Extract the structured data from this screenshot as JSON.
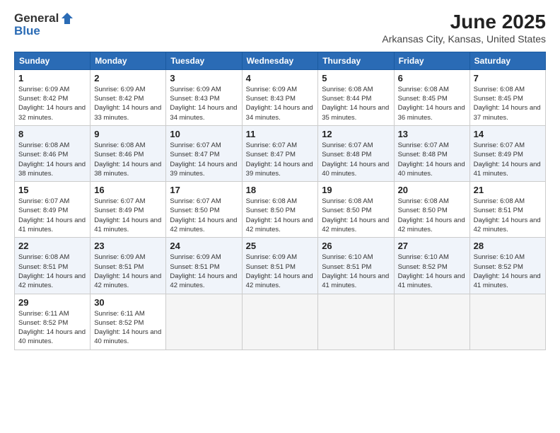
{
  "logo": {
    "general": "General",
    "blue": "Blue"
  },
  "title": "June 2025",
  "subtitle": "Arkansas City, Kansas, United States",
  "headers": [
    "Sunday",
    "Monday",
    "Tuesday",
    "Wednesday",
    "Thursday",
    "Friday",
    "Saturday"
  ],
  "weeks": [
    [
      {
        "day": "1",
        "sunrise": "6:09 AM",
        "sunset": "8:42 PM",
        "daylight": "14 hours and 32 minutes."
      },
      {
        "day": "2",
        "sunrise": "6:09 AM",
        "sunset": "8:42 PM",
        "daylight": "14 hours and 33 minutes."
      },
      {
        "day": "3",
        "sunrise": "6:09 AM",
        "sunset": "8:43 PM",
        "daylight": "14 hours and 34 minutes."
      },
      {
        "day": "4",
        "sunrise": "6:09 AM",
        "sunset": "8:43 PM",
        "daylight": "14 hours and 34 minutes."
      },
      {
        "day": "5",
        "sunrise": "6:08 AM",
        "sunset": "8:44 PM",
        "daylight": "14 hours and 35 minutes."
      },
      {
        "day": "6",
        "sunrise": "6:08 AM",
        "sunset": "8:45 PM",
        "daylight": "14 hours and 36 minutes."
      },
      {
        "day": "7",
        "sunrise": "6:08 AM",
        "sunset": "8:45 PM",
        "daylight": "14 hours and 37 minutes."
      }
    ],
    [
      {
        "day": "8",
        "sunrise": "6:08 AM",
        "sunset": "8:46 PM",
        "daylight": "14 hours and 38 minutes."
      },
      {
        "day": "9",
        "sunrise": "6:08 AM",
        "sunset": "8:46 PM",
        "daylight": "14 hours and 38 minutes."
      },
      {
        "day": "10",
        "sunrise": "6:07 AM",
        "sunset": "8:47 PM",
        "daylight": "14 hours and 39 minutes."
      },
      {
        "day": "11",
        "sunrise": "6:07 AM",
        "sunset": "8:47 PM",
        "daylight": "14 hours and 39 minutes."
      },
      {
        "day": "12",
        "sunrise": "6:07 AM",
        "sunset": "8:48 PM",
        "daylight": "14 hours and 40 minutes."
      },
      {
        "day": "13",
        "sunrise": "6:07 AM",
        "sunset": "8:48 PM",
        "daylight": "14 hours and 40 minutes."
      },
      {
        "day": "14",
        "sunrise": "6:07 AM",
        "sunset": "8:49 PM",
        "daylight": "14 hours and 41 minutes."
      }
    ],
    [
      {
        "day": "15",
        "sunrise": "6:07 AM",
        "sunset": "8:49 PM",
        "daylight": "14 hours and 41 minutes."
      },
      {
        "day": "16",
        "sunrise": "6:07 AM",
        "sunset": "8:49 PM",
        "daylight": "14 hours and 41 minutes."
      },
      {
        "day": "17",
        "sunrise": "6:07 AM",
        "sunset": "8:50 PM",
        "daylight": "14 hours and 42 minutes."
      },
      {
        "day": "18",
        "sunrise": "6:08 AM",
        "sunset": "8:50 PM",
        "daylight": "14 hours and 42 minutes."
      },
      {
        "day": "19",
        "sunrise": "6:08 AM",
        "sunset": "8:50 PM",
        "daylight": "14 hours and 42 minutes."
      },
      {
        "day": "20",
        "sunrise": "6:08 AM",
        "sunset": "8:50 PM",
        "daylight": "14 hours and 42 minutes."
      },
      {
        "day": "21",
        "sunrise": "6:08 AM",
        "sunset": "8:51 PM",
        "daylight": "14 hours and 42 minutes."
      }
    ],
    [
      {
        "day": "22",
        "sunrise": "6:08 AM",
        "sunset": "8:51 PM",
        "daylight": "14 hours and 42 minutes."
      },
      {
        "day": "23",
        "sunrise": "6:09 AM",
        "sunset": "8:51 PM",
        "daylight": "14 hours and 42 minutes."
      },
      {
        "day": "24",
        "sunrise": "6:09 AM",
        "sunset": "8:51 PM",
        "daylight": "14 hours and 42 minutes."
      },
      {
        "day": "25",
        "sunrise": "6:09 AM",
        "sunset": "8:51 PM",
        "daylight": "14 hours and 42 minutes."
      },
      {
        "day": "26",
        "sunrise": "6:10 AM",
        "sunset": "8:51 PM",
        "daylight": "14 hours and 41 minutes."
      },
      {
        "day": "27",
        "sunrise": "6:10 AM",
        "sunset": "8:52 PM",
        "daylight": "14 hours and 41 minutes."
      },
      {
        "day": "28",
        "sunrise": "6:10 AM",
        "sunset": "8:52 PM",
        "daylight": "14 hours and 41 minutes."
      }
    ],
    [
      {
        "day": "29",
        "sunrise": "6:11 AM",
        "sunset": "8:52 PM",
        "daylight": "14 hours and 40 minutes."
      },
      {
        "day": "30",
        "sunrise": "6:11 AM",
        "sunset": "8:52 PM",
        "daylight": "14 hours and 40 minutes."
      },
      null,
      null,
      null,
      null,
      null
    ]
  ]
}
